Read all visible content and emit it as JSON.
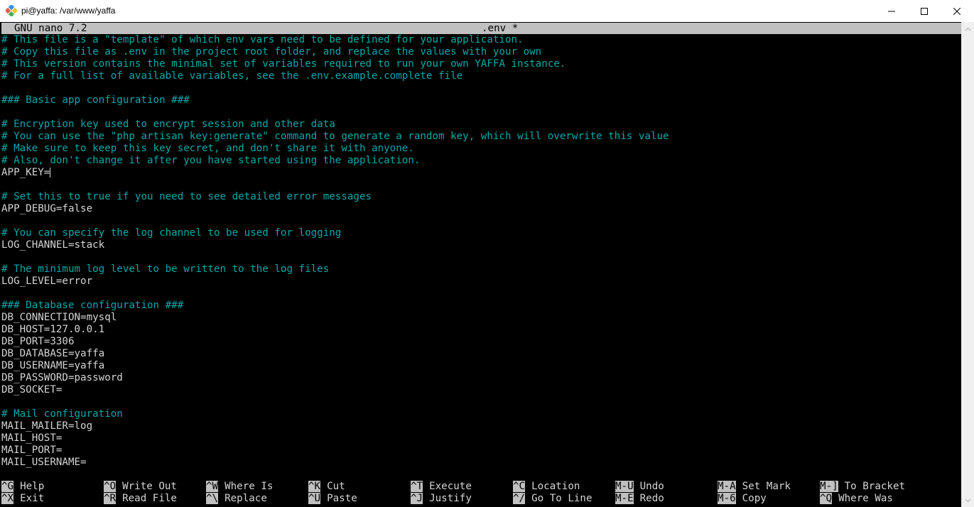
{
  "window": {
    "title": "pi@yaffa: /var/www/yaffa",
    "icon": "putty-icon",
    "controls": [
      "minimize-icon",
      "maximize-icon",
      "close-icon"
    ]
  },
  "nano": {
    "version_label": "GNU nano 7.2",
    "filename": ".env *"
  },
  "editor": {
    "lines": [
      {
        "text": "# This file is a \"template\" of which env vars need to be defined for your application.",
        "type": "comment"
      },
      {
        "text": "# Copy this file as .env in the project root folder, and replace the values with your own",
        "type": "comment"
      },
      {
        "text": "# This version contains the minimal set of variables required to run your own YAFFA instance.",
        "type": "comment"
      },
      {
        "text": "# For a full list of available variables, see the .env.example.complete file",
        "type": "comment"
      },
      {
        "text": "",
        "type": "blank"
      },
      {
        "text": "### Basic app configuration ###",
        "type": "comment"
      },
      {
        "text": "",
        "type": "blank"
      },
      {
        "text": "# Encryption key used to encrypt session and other data",
        "type": "comment"
      },
      {
        "text": "# You can use the \"php artisan key:generate\" command to generate a random key, which will overwrite this value",
        "type": "comment"
      },
      {
        "text": "# Make sure to keep this key secret, and don't share it with anyone.",
        "type": "comment"
      },
      {
        "text": "# Also, don't change it after you have started using the application.",
        "type": "comment"
      },
      {
        "text": "APP_KEY=",
        "type": "value",
        "cursor": true
      },
      {
        "text": "",
        "type": "blank"
      },
      {
        "text": "# Set this to true if you need to see detailed error messages",
        "type": "comment"
      },
      {
        "text": "APP_DEBUG=false",
        "type": "value"
      },
      {
        "text": "",
        "type": "blank"
      },
      {
        "text": "# You can specify the log channel to be used for logging",
        "type": "comment"
      },
      {
        "text": "LOG_CHANNEL=stack",
        "type": "value"
      },
      {
        "text": "",
        "type": "blank"
      },
      {
        "text": "# The minimum log level to be written to the log files",
        "type": "comment"
      },
      {
        "text": "LOG_LEVEL=error",
        "type": "value"
      },
      {
        "text": "",
        "type": "blank"
      },
      {
        "text": "### Database configuration ###",
        "type": "comment"
      },
      {
        "text": "DB_CONNECTION=mysql",
        "type": "value"
      },
      {
        "text": "DB_HOST=127.0.0.1",
        "type": "value"
      },
      {
        "text": "DB_PORT=3306",
        "type": "value"
      },
      {
        "text": "DB_DATABASE=yaffa",
        "type": "value"
      },
      {
        "text": "DB_USERNAME=yaffa",
        "type": "value"
      },
      {
        "text": "DB_PASSWORD=password",
        "type": "value"
      },
      {
        "text": "DB_SOCKET=",
        "type": "value"
      },
      {
        "text": "",
        "type": "blank"
      },
      {
        "text": "# Mail configuration",
        "type": "comment"
      },
      {
        "text": "MAIL_MAILER=log",
        "type": "value"
      },
      {
        "text": "MAIL_HOST=",
        "type": "value"
      },
      {
        "text": "MAIL_PORT=",
        "type": "value"
      },
      {
        "text": "MAIL_USERNAME=",
        "type": "value"
      }
    ]
  },
  "shortcuts": [
    {
      "key": "^G",
      "label": "Help",
      "col": 0,
      "row": 0
    },
    {
      "key": "^X",
      "label": "Exit",
      "col": 0,
      "row": 1
    },
    {
      "key": "^O",
      "label": "Write Out",
      "col": 1,
      "row": 0
    },
    {
      "key": "^R",
      "label": "Read File",
      "col": 1,
      "row": 1
    },
    {
      "key": "^W",
      "label": "Where Is",
      "col": 2,
      "row": 0
    },
    {
      "key": "^\\",
      "label": "Replace",
      "col": 2,
      "row": 1
    },
    {
      "key": "^K",
      "label": "Cut",
      "col": 3,
      "row": 0
    },
    {
      "key": "^U",
      "label": "Paste",
      "col": 3,
      "row": 1
    },
    {
      "key": "^T",
      "label": "Execute",
      "col": 4,
      "row": 0
    },
    {
      "key": "^J",
      "label": "Justify",
      "col": 4,
      "row": 1
    },
    {
      "key": "^C",
      "label": "Location",
      "col": 5,
      "row": 0
    },
    {
      "key": "^/",
      "label": "Go To Line",
      "col": 5,
      "row": 1
    },
    {
      "key": "M-U",
      "label": "Undo",
      "col": 6,
      "row": 0
    },
    {
      "key": "M-E",
      "label": "Redo",
      "col": 6,
      "row": 1
    },
    {
      "key": "M-A",
      "label": "Set Mark",
      "col": 7,
      "row": 0
    },
    {
      "key": "M-6",
      "label": "Copy",
      "col": 7,
      "row": 1
    },
    {
      "key": "M-]",
      "label": "To Bracket",
      "col": 8,
      "row": 0
    },
    {
      "key": "^Q",
      "label": "Where Was",
      "col": 8,
      "row": 1
    }
  ],
  "colors": {
    "comment": "#00a8a8",
    "text": "#d4d4d4",
    "background": "#000000",
    "bar": "#c0c0c0"
  }
}
